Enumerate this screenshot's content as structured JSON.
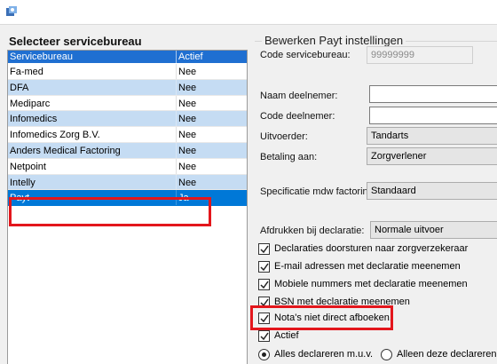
{
  "window": {
    "icon": "app-icon"
  },
  "left": {
    "title": "Selecteer servicebureau",
    "columns": [
      "Servicebureau",
      "Actief"
    ],
    "rows": [
      {
        "name": "Fa-med",
        "actief": "Nee"
      },
      {
        "name": "DFA",
        "actief": "Nee"
      },
      {
        "name": "Mediparc",
        "actief": "Nee"
      },
      {
        "name": "Infomedics",
        "actief": "Nee"
      },
      {
        "name": "Infomedics Zorg B.V.",
        "actief": "Nee"
      },
      {
        "name": "Anders Medical Factoring",
        "actief": "Nee"
      },
      {
        "name": "Netpoint",
        "actief": "Nee"
      },
      {
        "name": "Intelly",
        "actief": "Nee"
      },
      {
        "name": "Payt",
        "actief": "Ja"
      }
    ],
    "selected_row": "Payt"
  },
  "right": {
    "title": "Bewerken Payt instellingen",
    "code_servicebureau_label": "Code servicebureau:",
    "code_servicebureau_value": "99999999",
    "naam_deelnemer_label": "Naam deelnemer:",
    "naam_deelnemer_value": "",
    "code_deelnemer_label": "Code deelnemer:",
    "code_deelnemer_value": "",
    "uitvoerder_label": "Uitvoerder:",
    "uitvoerder_value": "Tandarts",
    "betaling_label": "Betaling aan:",
    "betaling_value": "Zorgverlener",
    "specificatie_label": "Specificatie mdw factoring:",
    "specificatie_value": "Standaard",
    "afdrukken_label": "Afdrukken bij declaratie:",
    "afdrukken_value": "Normale uitvoer",
    "checkboxes": [
      {
        "label": "Declaraties doorsturen naar zorgverzekeraar",
        "checked": true
      },
      {
        "label": "E-mail adressen met declaratie meenemen",
        "checked": true
      },
      {
        "label": "Mobiele nummers met declaratie meenemen",
        "checked": true
      },
      {
        "label": "BSN met declaratie meenemen",
        "checked": true
      },
      {
        "label": "Nota's niet direct afboeken.",
        "checked": true
      },
      {
        "label": "Actief",
        "checked": true
      }
    ],
    "radios": [
      {
        "label": "Alles declareren m.u.v.",
        "selected": true
      },
      {
        "label": "Alleen deze declareren",
        "selected": false
      }
    ]
  },
  "colors": {
    "header_blue": "#1f6fd1",
    "row_alt": "#c5dcf3",
    "row_selected": "#0078d7",
    "highlight_red": "#e3161c"
  }
}
